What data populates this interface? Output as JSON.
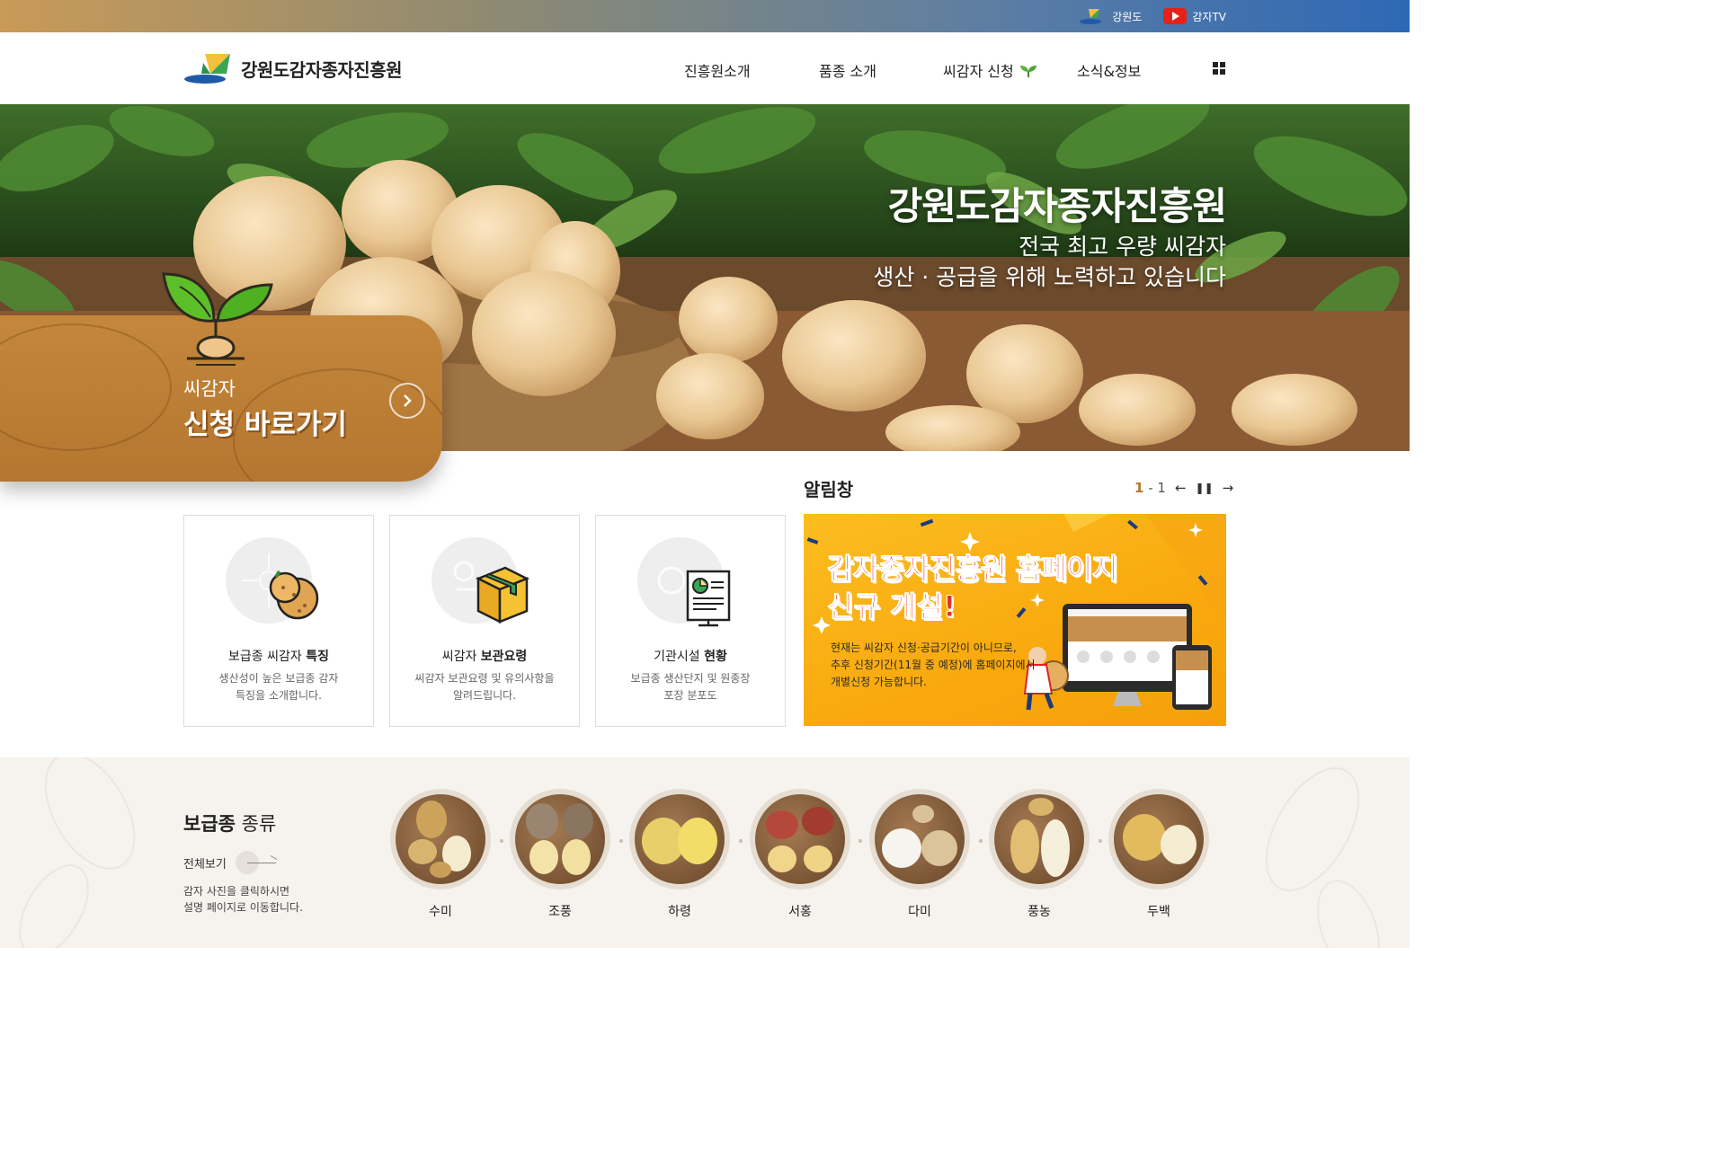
{
  "topbar": {
    "links": [
      {
        "label": "강원도",
        "icon": "gangwon-logo-icon"
      },
      {
        "label": "감자TV",
        "icon": "youtube-icon"
      }
    ]
  },
  "header": {
    "logo_text": "강원도감자종자진흥원",
    "nav": [
      "진흥원소개",
      "품종 소개",
      "씨감자 신청",
      "소식&정보"
    ],
    "menu_icon": "grid-menu-icon"
  },
  "hero": {
    "title": "강원도감자종자진흥원",
    "subtitle_line1": "전국 최고 우량 씨감자",
    "subtitle_line2": "생산 · 공급을 위해 노력하고 있습니다"
  },
  "apply": {
    "label_small": "씨감자",
    "label_big": "신청 바로가기"
  },
  "cards": [
    {
      "title_normal": "보급종 씨감자 ",
      "title_bold": "특징",
      "desc_line1": "생산성이 높은 보급종 감자",
      "desc_line2": "특징을 소개합니다.",
      "icon": "potato-icon"
    },
    {
      "title_normal": "씨감자 ",
      "title_bold": "보관요령",
      "desc_line1": "씨감자 보관요령 및 유의사항을",
      "desc_line2": "알려드립니다.",
      "icon": "storage-box-icon"
    },
    {
      "title_normal": "기관시설 ",
      "title_bold": "현황",
      "desc_line1": "보급종 생산단지 및 원종장",
      "desc_line2": "포장 분포도",
      "icon": "report-monitor-icon"
    }
  ],
  "notice": {
    "title": "알림창",
    "page_current": "1",
    "page_sep": " - ",
    "page_total": "1",
    "banner_h1": "감자종자진흥원 홈페이지",
    "banner_h2": "신규 개설!",
    "banner_body_1": "현재는 씨감자 신청·공급기간이 아니므로,",
    "banner_body_2": "추후 신청기간(11월 중 예정)에 홈페이지에서",
    "banner_body_3": "개별신청 가능합니다."
  },
  "varieties": {
    "title_bold": "보급종",
    "title_normal": " 종류",
    "view_all": "전체보기",
    "desc_line1": "감자 사진을 클릭하시면",
    "desc_line2": "설명 페이지로 이동합니다.",
    "items": [
      "수미",
      "조풍",
      "하령",
      "서홍",
      "다미",
      "풍농",
      "두백"
    ]
  },
  "colors": {
    "accent_brown": "#b5762f",
    "notice_red": "#e2332b",
    "banner_yellow": "#fbbd20"
  }
}
